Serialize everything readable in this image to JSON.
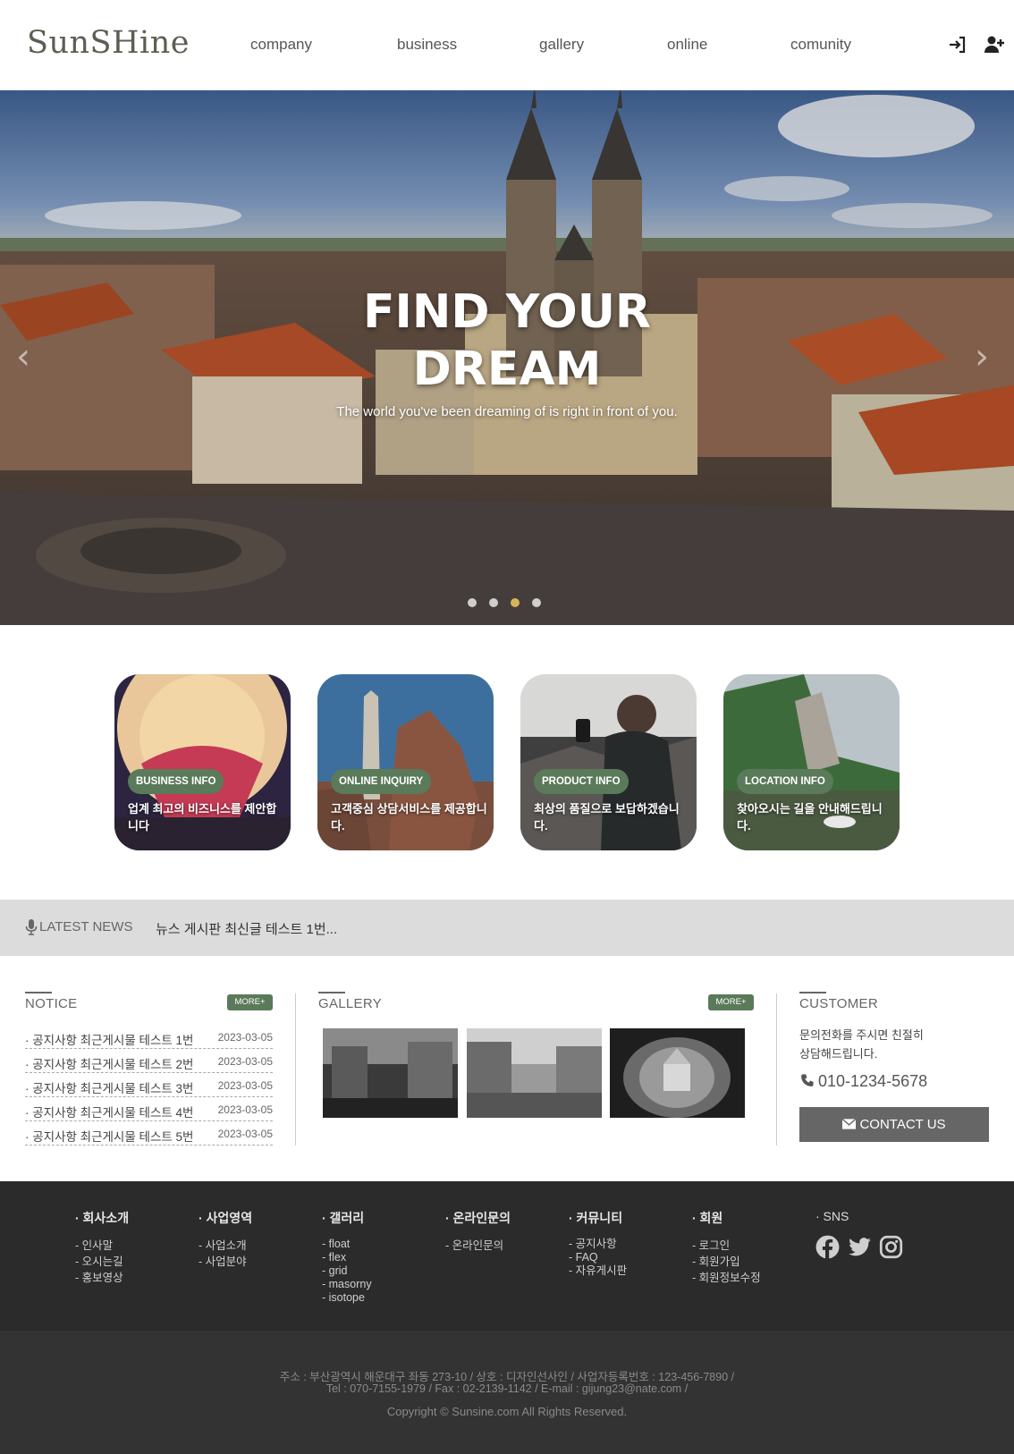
{
  "header": {
    "logo": "SunSHine",
    "nav": [
      "company",
      "business",
      "gallery",
      "online",
      "comunity"
    ],
    "icons": [
      "login-icon",
      "add-user-icon"
    ]
  },
  "hero": {
    "title": "FIND YOUR DREAM",
    "subtitle": "The world you've been dreaming of is right in front of you.",
    "prev_icon": "chevron-left-icon",
    "next_icon": "chevron-right-icon",
    "slide_count": 4,
    "active_slide": 3
  },
  "cards": [
    {
      "badge": "BUSINESS INFO",
      "text": "업계 최고의 비즈니스를 제안합니다"
    },
    {
      "badge": "ONLINE INQUIRY",
      "text": "고객중심 상담서비스를 제공합니다."
    },
    {
      "badge": "PRODUCT INFO",
      "text": "최상의 품질으로 보답하겠습니다."
    },
    {
      "badge": "LOCATION INFO",
      "text": "찾아오시는 길을 안내해드립니다."
    }
  ],
  "news": {
    "icon": "microphone-icon",
    "label": "LATEST NEWS",
    "text": "뉴스 게시판 최신글 테스트 1번..."
  },
  "notice": {
    "title": "NOTICE",
    "more": "MORE+",
    "items": [
      {
        "title": "· 공지사항 최근게시물 테스트 1번",
        "date": "2023-03-05"
      },
      {
        "title": "· 공지사항 최근게시물 테스트 2번",
        "date": "2023-03-05"
      },
      {
        "title": "· 공지사항 최근게시물 테스트 3번",
        "date": "2023-03-05"
      },
      {
        "title": "· 공지사항 최근게시물 테스트 4번",
        "date": "2023-03-05"
      },
      {
        "title": "· 공지사항 최근게시물 테스트 5번",
        "date": "2023-03-05"
      }
    ]
  },
  "gallery": {
    "title": "GALLERY",
    "more": "MORE+"
  },
  "customer": {
    "title": "CUSTOMER",
    "line1": "문의전화를 주시면 친절히",
    "line2": "상담해드립니다.",
    "phone_icon": "phone-icon",
    "phone": "010-1234-5678",
    "button_icon": "envelope-icon",
    "button": "CONTACT US"
  },
  "footer": {
    "columns": [
      {
        "title": "· 회사소개",
        "items": [
          "- 인사말",
          "- 오시는길",
          "- 홍보영상"
        ]
      },
      {
        "title": "· 사업영역",
        "items": [
          "- 사업소개",
          "- 사업분야"
        ]
      },
      {
        "title": "· 갤러리",
        "items": [
          "- float",
          "- flex",
          "- grid",
          "- masorny",
          "- isotope"
        ]
      },
      {
        "title": "· 온라인문의",
        "items": [
          "- 온라인문의"
        ]
      },
      {
        "title": "· 커뮤니티",
        "items": [
          "- 공지사항",
          "- FAQ",
          "- 자유게시판"
        ]
      },
      {
        "title": "· 회원",
        "items": [
          "- 로그인",
          "- 회원가입",
          "- 회원정보수정"
        ]
      }
    ],
    "sns_title": "· SNS",
    "sns_icons": [
      "facebook-icon",
      "twitter-icon",
      "instagram-icon"
    ],
    "address_line1": "주소 : 부산광역시 해운대구 좌동 273-10  /  상호 : 디자인선사인  /  사업자등록번호 : 123-456-7890  /",
    "address_line2": "Tel : 070-7155-1979  /  Fax : 02-2139-1142  /  E-mail : gijung23@nate.com  /",
    "copyright": "Copyright © Sunsine.com All Rights Reserved."
  },
  "colors": {
    "accent_green": "#5a7a5a",
    "footer_dark": "#2b2b2b",
    "news_bar": "#dcdcdc",
    "button_gray": "#666666"
  }
}
